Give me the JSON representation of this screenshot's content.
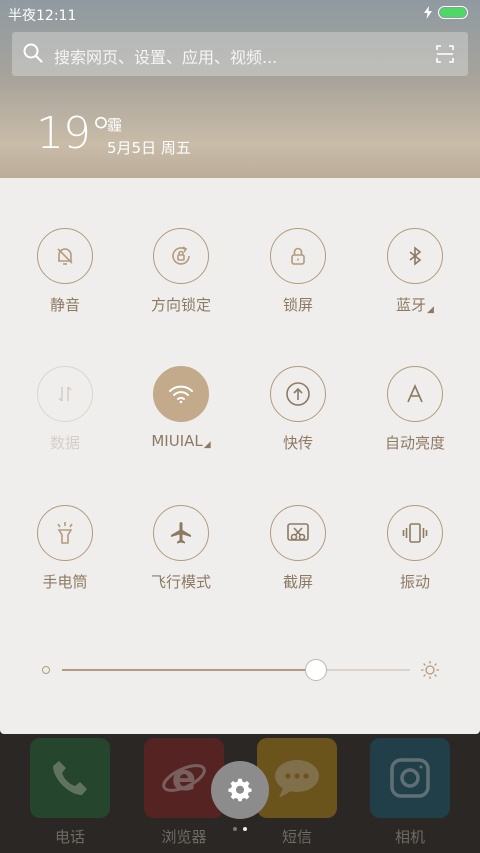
{
  "status_bar": {
    "time": "半夜12:11",
    "battery_level": 1.0,
    "charging": true
  },
  "search": {
    "placeholder": "搜索网页、设置、应用、视频..."
  },
  "weather": {
    "temperature": "19°",
    "condition": "霾",
    "date": "5月5日 周五"
  },
  "toggles": [
    {
      "label": "静音",
      "icon": "bell-off-icon",
      "state": "off"
    },
    {
      "label": "方向锁定",
      "icon": "rotation-lock-icon",
      "state": "off"
    },
    {
      "label": "锁屏",
      "icon": "lock-icon",
      "state": "off"
    },
    {
      "label": "蓝牙",
      "icon": "bluetooth-icon",
      "state": "off",
      "has_menu": true
    },
    {
      "label": "数据",
      "icon": "mobile-data-icon",
      "state": "disabled"
    },
    {
      "label": "MIUIAL",
      "icon": "wifi-icon",
      "state": "on",
      "has_menu": true
    },
    {
      "label": "快传",
      "icon": "quick-transfer-icon",
      "state": "off"
    },
    {
      "label": "自动亮度",
      "icon": "auto-brightness-icon",
      "state": "off"
    },
    {
      "label": "手电筒",
      "icon": "flashlight-icon",
      "state": "off"
    },
    {
      "label": "飞行模式",
      "icon": "airplane-icon",
      "state": "off"
    },
    {
      "label": "截屏",
      "icon": "screenshot-icon",
      "state": "off"
    },
    {
      "label": "振动",
      "icon": "vibrate-icon",
      "state": "off"
    }
  ],
  "brightness": {
    "level": 0.73
  },
  "dock": [
    {
      "label": "电话",
      "icon": "phone-icon",
      "color": "#1f6b3a"
    },
    {
      "label": "浏览器",
      "icon": "browser-icon",
      "color": "#8a1f23"
    },
    {
      "label": "短信",
      "icon": "message-icon",
      "color": "#b98a14"
    },
    {
      "label": "相机",
      "icon": "camera-icon",
      "color": "#155e76"
    }
  ],
  "pager": {
    "pages": 2,
    "current": 2
  },
  "colors": {
    "accent": "#b39b7d",
    "active_fill": "#c3aa8b",
    "panel_bg": "#efeeec"
  }
}
